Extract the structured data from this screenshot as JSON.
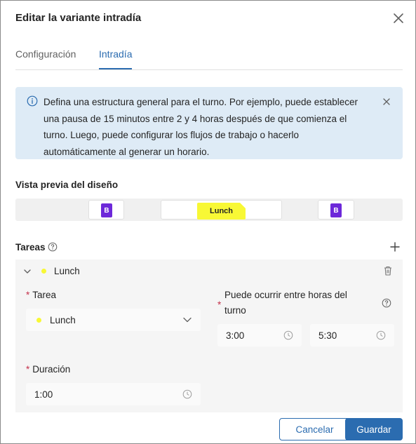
{
  "dialog": {
    "title": "Editar la variante intradía"
  },
  "tabs": [
    {
      "label": "Configuración",
      "active": false
    },
    {
      "label": "Intradía",
      "active": true
    }
  ],
  "banner": {
    "text": "Defina una estructura general para el turno. Por ejemplo, puede establecer una pausa de 15 minutos entre 2 y 4 horas después de que comienza el turno. Luego, puede configurar los flujos de trabajo o hacerlo automáticamente al generar un horario."
  },
  "preview": {
    "label": "Vista previa del diseño",
    "break_badge": "B",
    "lunch_label": "Lunch"
  },
  "tareas": {
    "label": "Tareas"
  },
  "task": {
    "name": "Lunch",
    "tarea_label": "Tarea",
    "tarea_value": "Lunch",
    "window_label": "Puede ocurrir entre horas del turno",
    "window_start": "3:00",
    "window_end": "5:30",
    "duration_label": "Duración",
    "duration_value": "1:00"
  },
  "footer": {
    "cancel_label": "Cancelar",
    "save_label": "Guardar"
  },
  "colors": {
    "accent": "#2b6cb0",
    "lunch": "#f8f835",
    "break": "#6d28d9",
    "banner_bg": "#deebf6",
    "required": "#c4314b"
  }
}
